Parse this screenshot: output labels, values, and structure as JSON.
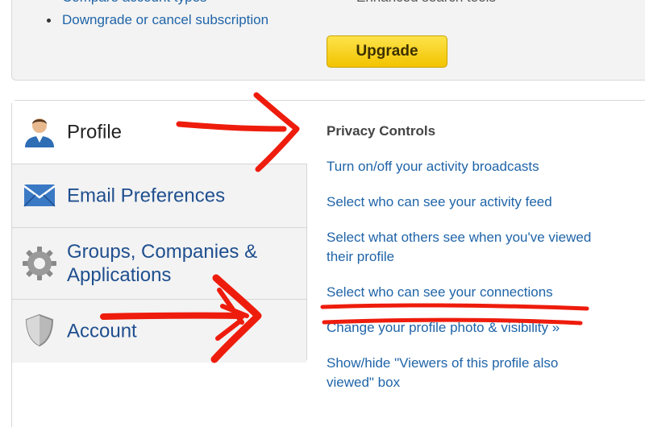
{
  "top_box": {
    "left_items": [
      "Compare account types",
      "Downgrade or cancel subscription"
    ],
    "right_items": [
      "Enhanced search tools"
    ],
    "upgrade_label": "Upgrade"
  },
  "nav": {
    "items": [
      {
        "label": "Profile",
        "icon": "person-icon",
        "active": true
      },
      {
        "label": "Email Preferences",
        "icon": "envelope-icon",
        "active": false
      },
      {
        "label": "Groups, Companies & Applications",
        "icon": "gear-icon",
        "active": false
      },
      {
        "label": "Account",
        "icon": "shield-icon",
        "active": false
      }
    ]
  },
  "content": {
    "heading": "Privacy Controls",
    "links": [
      "Turn on/off your activity broadcasts",
      "Select who can see your activity feed",
      "Select what others see when you've viewed their profile",
      "Select who can see your connections",
      "Change your profile photo & visibility »",
      "Show/hide \"Viewers of this profile also viewed\" box"
    ]
  },
  "colors": {
    "link": "#1f64a8",
    "nav_text": "#1f4f8f",
    "button": "#f6cf17",
    "annotation": "#ee1c0c"
  }
}
